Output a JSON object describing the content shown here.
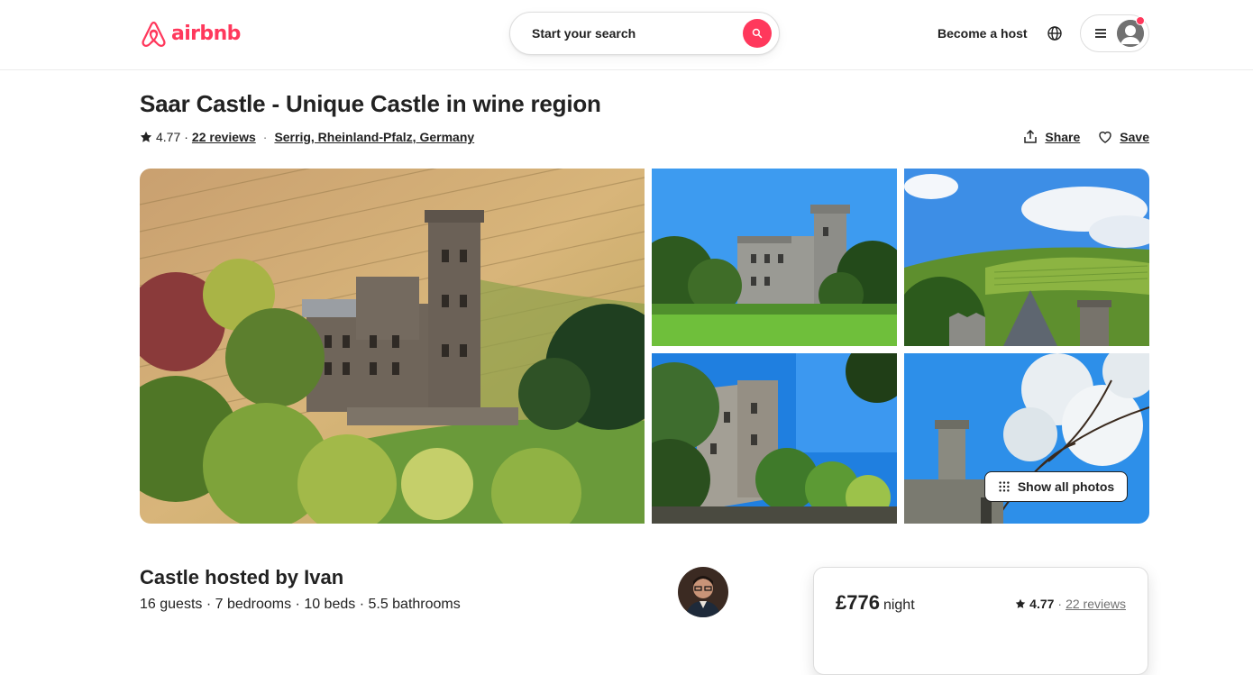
{
  "brand": {
    "name": "airbnb",
    "color": "#ff385c",
    "logo_icon": "airbnb-belo-icon"
  },
  "search": {
    "label": "Start your search",
    "icon": "search-icon"
  },
  "header": {
    "become_host": "Become a host",
    "globe_icon": "globe-icon",
    "menu_icon": "hamburger-menu-icon",
    "avatar_icon": "user-avatar-icon"
  },
  "listing": {
    "title": "Saar Castle - Unique Castle in wine region",
    "rating": "4.77",
    "dot": "·",
    "reviews": "22 reviews",
    "location": "Serrig, Rheinland-Pfalz, Germany",
    "share": "Share",
    "save": "Save"
  },
  "gallery": {
    "show_all": "Show all photos",
    "photos": [
      {
        "alt": "Castle among vineyards",
        "icon": "photo"
      },
      {
        "alt": "Castle front under blue sky",
        "icon": "photo"
      },
      {
        "alt": "Vineyard hills view",
        "icon": "photo"
      },
      {
        "alt": "Castle wall with trees",
        "icon": "photo"
      },
      {
        "alt": "Tower with blossoms",
        "icon": "photo"
      }
    ]
  },
  "host": {
    "title": "Castle hosted by Ivan",
    "details": "16 guests · 7 bedrooms · 10 beds · 5.5 bathrooms"
  },
  "booking": {
    "price": "£776",
    "unit": "night",
    "rating": "4.77",
    "dot": "·",
    "reviews": "22 reviews"
  }
}
